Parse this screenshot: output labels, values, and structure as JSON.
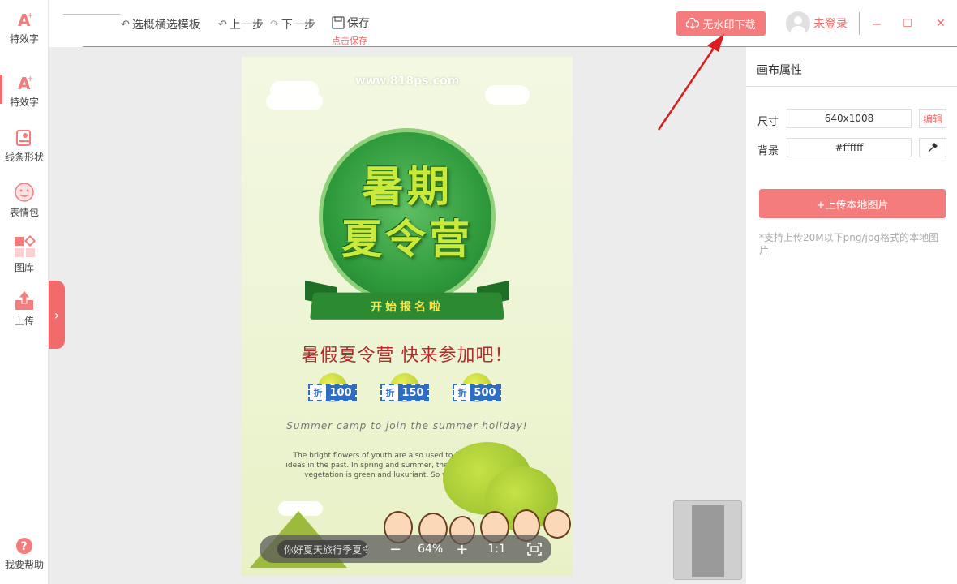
{
  "sidebar": {
    "items": [
      {
        "label": "特效字",
        "icon": "text-effect-icon"
      },
      {
        "label": "特效字",
        "icon": "text-effect-icon"
      },
      {
        "label": "线条形状",
        "icon": "shape-icon"
      },
      {
        "label": "表情包",
        "icon": "emoji-icon"
      },
      {
        "label": "图库",
        "icon": "gallery-icon"
      },
      {
        "label": "上传",
        "icon": "upload-icon"
      }
    ],
    "help": "我要帮助",
    "expand": "›"
  },
  "toolbar": {
    "template": "选概横选模板",
    "undo": "上一步",
    "redo": "下一步",
    "save": "保存",
    "save_hint": "点击保存",
    "download": "无水印下载",
    "user": "未登录",
    "minimize": "−",
    "maximize": "☐",
    "close": "✕"
  },
  "poster": {
    "url": "www.818ps.com",
    "title1": "暑期",
    "title2": "夏令营",
    "ribbon": "开始报名啦",
    "slogan": "暑假夏令营 快来参加吧！",
    "coupons": [
      {
        "prefix": "折",
        "value": "100"
      },
      {
        "prefix": "折",
        "value": "150"
      },
      {
        "prefix": "折",
        "value": "500"
      }
    ],
    "english": "Summer camp to join the summer holiday!",
    "paragraph": "The bright flowers of youth are also used to bring forth new ideas in the past. In spring and summer, the vigorous growth of vegetation is green and luxuriant. So we call it youth."
  },
  "zoom": {
    "layer_name": "你好夏天旅行季夏令",
    "minus": "−",
    "value": "64%",
    "plus": "+",
    "one_to_one": "1:1"
  },
  "panel": {
    "title": "画布属性",
    "size_label": "尺寸",
    "size_value": "640x1008",
    "edit": "编辑",
    "bg_label": "背景",
    "bg_value": "#ffffff",
    "upload": "+上传本地图片",
    "note": "*支持上传20M以下png/jpg格式的本地图片"
  },
  "colors": {
    "accent": "#f26b6b",
    "button": "#f47c7c",
    "poster_green": "#2b8a32"
  }
}
